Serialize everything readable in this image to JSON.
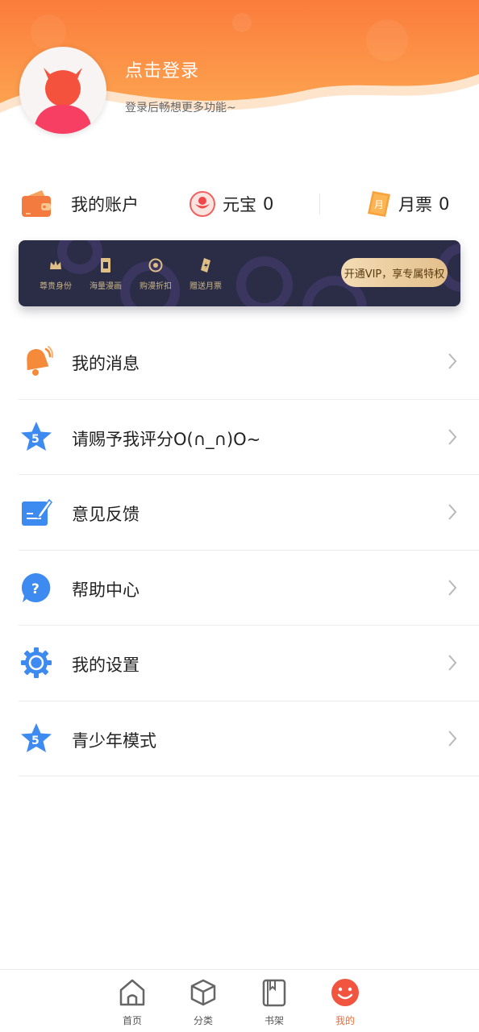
{
  "header": {
    "login_title": "点击登录",
    "login_subtitle": "登录后畅想更多功能~"
  },
  "account": {
    "my_account_label": "我的账户",
    "yuanbao_label": "元宝",
    "yuanbao_value": "0",
    "yuepiao_label": "月票",
    "yuepiao_value": "0"
  },
  "vip": {
    "features": [
      {
        "label": "尊贵身份",
        "icon": "crown-icon"
      },
      {
        "label": "海量漫画",
        "icon": "comic-book-icon"
      },
      {
        "label": "购漫折扣",
        "icon": "coin-icon"
      },
      {
        "label": "赠送月票",
        "icon": "lightning-ticket-icon"
      }
    ],
    "button_label": "开通VIP，享专属特权"
  },
  "menu": [
    {
      "label": "我的消息",
      "icon": "bell-icon"
    },
    {
      "label": "请赐予我评分O(∩_∩)O~",
      "icon": "star-rating-icon"
    },
    {
      "label": "意见反馈",
      "icon": "feedback-edit-icon"
    },
    {
      "label": "帮助中心",
      "icon": "help-question-icon"
    },
    {
      "label": "我的设置",
      "icon": "settings-gear-icon"
    },
    {
      "label": "青少年模式",
      "icon": "star-rating-icon"
    }
  ],
  "tabs": [
    {
      "label": "首页",
      "icon": "home-icon",
      "active": false
    },
    {
      "label": "分类",
      "icon": "cube-icon",
      "active": false
    },
    {
      "label": "书架",
      "icon": "bookshelf-icon",
      "active": false
    },
    {
      "label": "我的",
      "icon": "smiley-icon",
      "active": true
    }
  ],
  "colors": {
    "brand_orange": "#f26b3a",
    "vip_dark": "#2a2d45",
    "vip_gold": "#e3c08c",
    "icon_blue": "#3d8bf0"
  }
}
